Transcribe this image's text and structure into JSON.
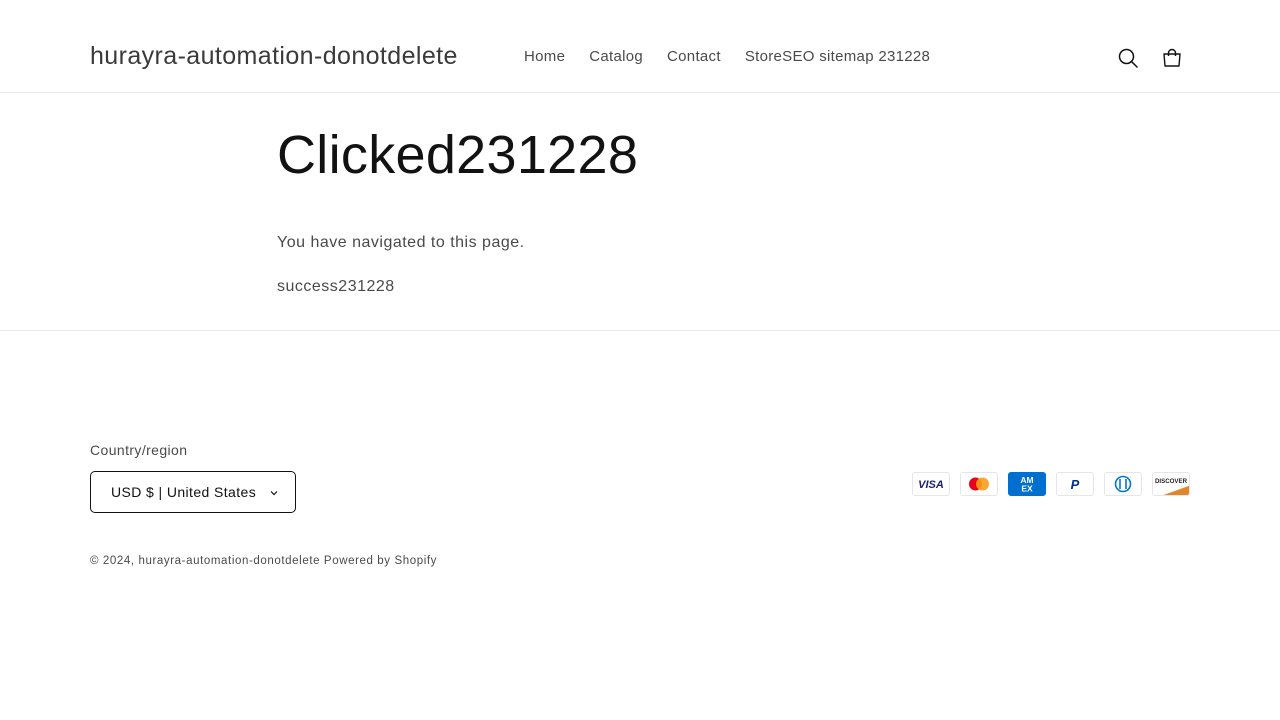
{
  "header": {
    "store_name": "hurayra-automation-donotdelete",
    "nav": [
      {
        "label": "Home"
      },
      {
        "label": "Catalog"
      },
      {
        "label": "Contact"
      },
      {
        "label": "StoreSEO sitemap 231228"
      }
    ],
    "icons": {
      "search": "search-icon",
      "cart": "cart-icon"
    }
  },
  "main": {
    "title": "Clicked231228",
    "paragraphs": [
      "You have navigated to this page.",
      "success231228"
    ]
  },
  "footer": {
    "country_label": "Country/region",
    "country_value": "USD $ | United States",
    "payment_methods": [
      "visa-icon",
      "mastercard-icon",
      "amex-icon",
      "paypal-icon",
      "diners-club-icon",
      "discover-icon"
    ],
    "copyright_prefix": "© 2024,",
    "copyright_store": "hurayra-automation-donotdelete",
    "powered_by": "Powered by Shopify"
  },
  "colors": {
    "text": "#121212",
    "muted": "#4a4a4a",
    "border": "#e8e8e8",
    "visa": "#1a1f71",
    "amex": "#016fd0",
    "discover": "#e3852c"
  }
}
